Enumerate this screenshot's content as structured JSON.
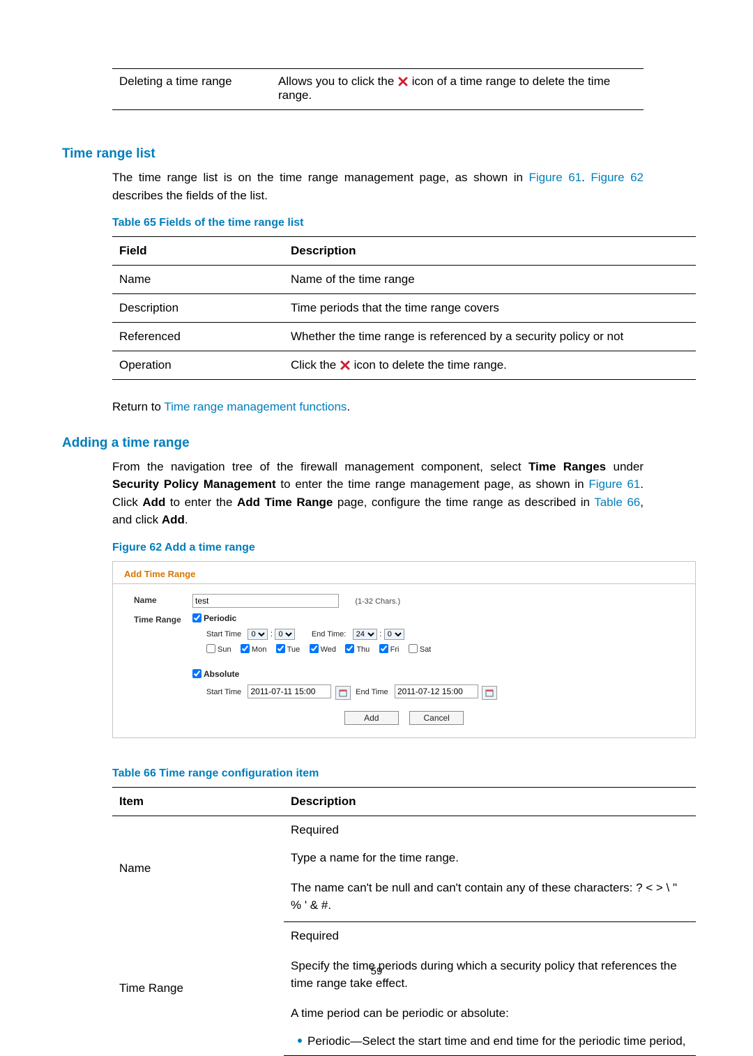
{
  "top_row": {
    "left": "Deleting a time range",
    "right_prefix": "Allows you to click the ",
    "right_suffix": " icon of a time range to delete the time range."
  },
  "section1": {
    "heading": "Time range list",
    "para_a": "The time range list is on the time range management page, as shown in ",
    "link1": "Figure 61",
    "sep1": ". ",
    "link2": "Figure 62",
    "para_b": " describes the fields of the list.",
    "caption": "Table 65 Fields of the time range list"
  },
  "table65": {
    "h1": "Field",
    "h2": "Description",
    "rows": [
      {
        "f": "Name",
        "d": "Name of the time range"
      },
      {
        "f": "Description",
        "d": "Time periods that the time range covers"
      },
      {
        "f": "Referenced",
        "d": "Whether the time range is referenced by a security policy or not"
      }
    ],
    "last": {
      "f": "Operation",
      "d_pre": "Click the ",
      "d_post": " icon to delete the time range."
    }
  },
  "return": {
    "prefix": "Return to ",
    "link": "Time range management functions",
    "suffix": "."
  },
  "section2": {
    "heading": "Adding a time range",
    "p1_a": "From the navigation tree of the firewall management component, select ",
    "b1": "Time Ranges",
    "p1_b": " under ",
    "b2": "Security Policy Management",
    "p1_c": " to enter the time range management page, as shown in ",
    "l1": "Figure 61",
    "p1_d": ". Click ",
    "b3": "Add",
    "p1_e": " to enter the ",
    "b4": "Add Time Range",
    "p1_f": " page, configure the time range as described in ",
    "l2": "Table 66",
    "p1_g": ", and click ",
    "b5": "Add",
    "p1_h": ".",
    "fig_caption": "Figure 62 Add a time range"
  },
  "figure": {
    "title": "Add Time Range",
    "name_label": "Name",
    "name_value": "test",
    "name_hint": "(1-32 Chars.)",
    "tr_label": "Time Range",
    "periodic": "Periodic",
    "start": "Start Time",
    "end": "End Time:",
    "sh": "0",
    "sm": "0",
    "eh": "24",
    "em": "0",
    "days": {
      "sun": "Sun",
      "mon": "Mon",
      "tue": "Tue",
      "wed": "Wed",
      "thu": "Thu",
      "fri": "Fri",
      "sat": "Sat"
    },
    "absolute": "Absolute",
    "abs_start": "Start Time",
    "abs_start_v": "2011-07-11 15:00",
    "abs_end": "End Time",
    "abs_end_v": "2011-07-12 15:00",
    "btn_add": "Add",
    "btn_cancel": "Cancel"
  },
  "table66": {
    "caption": "Table 66 Time range configuration item",
    "h1": "Item",
    "h2": "Description",
    "r1": {
      "item": "Name",
      "l1": "Required",
      "l2": "Type a name for the time range.",
      "l3": "The name can't be null and can't contain any of these characters: ? < > \\ \" % ' & #."
    },
    "r2": {
      "item": "Time Range",
      "l1": "Required",
      "l2": "Specify the time periods during which a security policy that references the time range take effect.",
      "l3": "A time period can be periodic or absolute:",
      "bullet": "Periodic—Select the start time and end time for the periodic time period,"
    }
  },
  "pagenum": "59"
}
